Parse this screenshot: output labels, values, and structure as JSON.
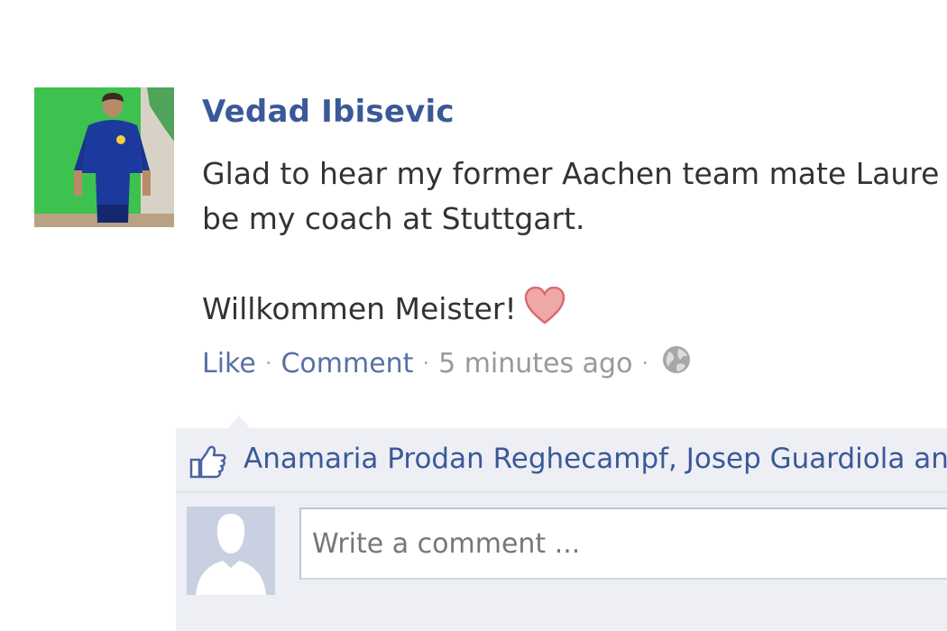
{
  "post": {
    "author": "Vedad Ibisevic",
    "text_line1": "Glad to hear my former Aachen team mate Laure",
    "text_line2": "be my coach at Stuttgart.",
    "text_line3": "Willkommen Meister!",
    "avatar_icon": "profile-photo",
    "heart_icon": "heart-emoticon"
  },
  "actions": {
    "like_label": "Like",
    "separator": "·",
    "comment_label": "Comment",
    "timestamp": "5 minutes ago",
    "privacy_icon": "globe-icon"
  },
  "feedback": {
    "likes_text": "Anamaria Prodan Reghecampf, Josep Guardiola and",
    "thumb_icon": "thumbs-up-icon",
    "comment_placeholder": "Write a comment ..."
  },
  "colors": {
    "link": "#3b5998",
    "text": "#333333",
    "muted": "#999999",
    "feedback_bg": "#edeff4"
  }
}
